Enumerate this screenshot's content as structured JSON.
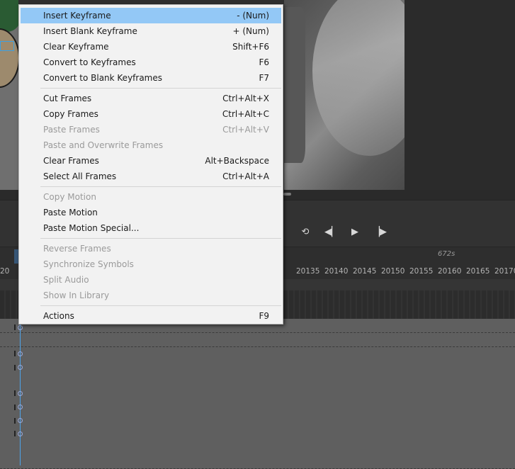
{
  "menu": {
    "groups": [
      [
        {
          "label": "Insert Keyframe",
          "shortcut": "- (Num)",
          "enabled": true,
          "highlighted": true
        },
        {
          "label": "Insert Blank Keyframe",
          "shortcut": "+ (Num)",
          "enabled": true
        },
        {
          "label": "Clear Keyframe",
          "shortcut": "Shift+F6",
          "enabled": true
        },
        {
          "label": "Convert to Keyframes",
          "shortcut": "F6",
          "enabled": true
        },
        {
          "label": "Convert to Blank Keyframes",
          "shortcut": "F7",
          "enabled": true
        }
      ],
      [
        {
          "label": "Cut Frames",
          "shortcut": "Ctrl+Alt+X",
          "enabled": true
        },
        {
          "label": "Copy Frames",
          "shortcut": "Ctrl+Alt+C",
          "enabled": true
        },
        {
          "label": "Paste Frames",
          "shortcut": "Ctrl+Alt+V",
          "enabled": false
        },
        {
          "label": "Paste and Overwrite Frames",
          "shortcut": "",
          "enabled": false
        },
        {
          "label": "Clear Frames",
          "shortcut": "Alt+Backspace",
          "enabled": true
        },
        {
          "label": "Select All Frames",
          "shortcut": "Ctrl+Alt+A",
          "enabled": true
        }
      ],
      [
        {
          "label": "Copy Motion",
          "shortcut": "",
          "enabled": false
        },
        {
          "label": "Paste Motion",
          "shortcut": "",
          "enabled": true
        },
        {
          "label": "Paste Motion Special...",
          "shortcut": "",
          "enabled": true
        }
      ],
      [
        {
          "label": "Reverse Frames",
          "shortcut": "",
          "enabled": false
        },
        {
          "label": "Synchronize Symbols",
          "shortcut": "",
          "enabled": false
        },
        {
          "label": "Split Audio",
          "shortcut": "",
          "enabled": false
        },
        {
          "label": "Show In Library",
          "shortcut": "",
          "enabled": false
        }
      ],
      [
        {
          "label": "Actions",
          "shortcut": "F9",
          "enabled": true
        }
      ]
    ]
  },
  "timeline": {
    "time_label": "672s",
    "ruler_ticks": [
      "20",
      "20135",
      "20140",
      "20145",
      "20150",
      "20155",
      "20160",
      "20165",
      "20170"
    ],
    "toolbar_icons": [
      "loop-icon",
      "step-back-icon",
      "play-icon",
      "step-forward-icon"
    ]
  },
  "colors": {
    "menu_bg": "#f2f2f2",
    "menu_highlight": "#93c8f6",
    "disabled_text": "#9a9a9a",
    "playhead": "#4ca3ea"
  }
}
